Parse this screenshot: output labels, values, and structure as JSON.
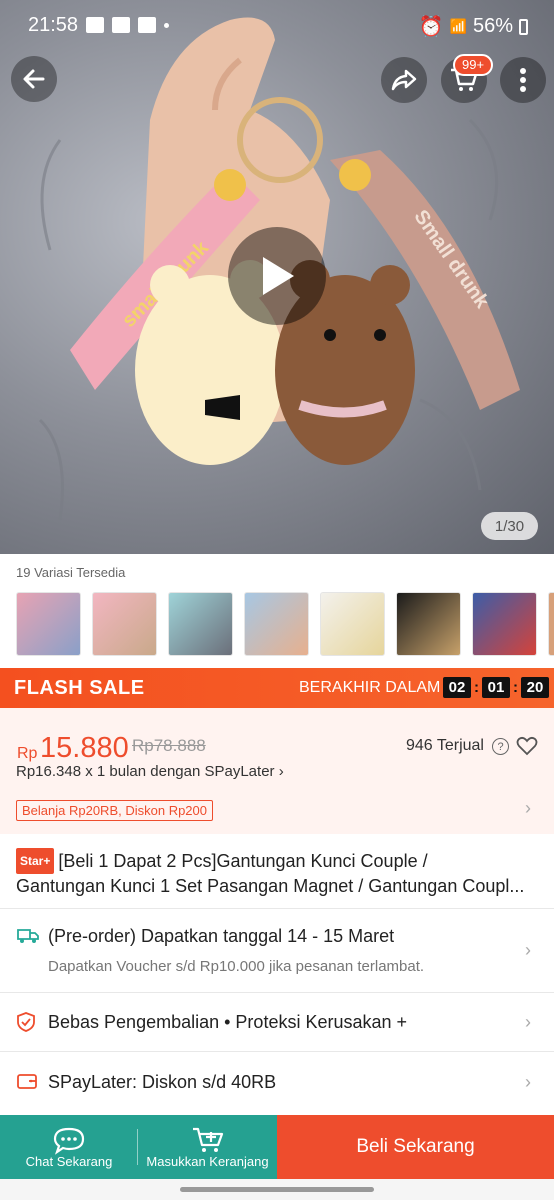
{
  "status_bar": {
    "time": "21:58",
    "battery": "56%"
  },
  "header": {
    "cart_badge": "99+",
    "icons": [
      "back-arrow-icon",
      "share-icon",
      "cart-icon",
      "more-vertical-icon"
    ]
  },
  "media": {
    "pager": "1/30"
  },
  "variations": {
    "label": "19 Variasi Tersedia"
  },
  "flash_sale": {
    "title": "FLASH SALE",
    "ends_label": "BERAKHIR DALAM",
    "hours": "02",
    "minutes": "01",
    "seconds": "20"
  },
  "price": {
    "currency": "Rp",
    "current": "15.880",
    "original": "Rp78.888",
    "sold": "946 Terjual",
    "installment": "Rp16.348 x 1 bulan dengan SPayLater",
    "promo": "Belanja Rp20RB, Diskon Rp200"
  },
  "product": {
    "badge": "Star+",
    "title_line1": "[Beli 1 Dapat 2 Pcs]Gantungan Kunci Couple /",
    "title_line2": "Gantungan Kunci 1 Set Pasangan Magnet / Gantungan Coupl..."
  },
  "shipping": {
    "main": "(Pre-order) Dapatkan tanggal 14 - 15 Maret",
    "sub": "Dapatkan Voucher s/d Rp10.000 jika pesanan terlambat."
  },
  "returns": {
    "main": "Bebas Pengembalian • Proteksi Kerusakan +"
  },
  "spaylater": {
    "main": "SPayLater: Diskon s/d 40RB"
  },
  "bottom_bar": {
    "chat": "Chat Sekarang",
    "add_cart": "Masukkan Keranjang",
    "buy": "Beli Sekarang"
  },
  "colors": {
    "accent": "#ee4d2d",
    "teal": "#25a191"
  }
}
